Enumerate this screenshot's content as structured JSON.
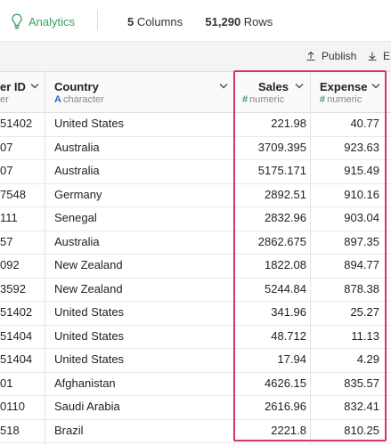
{
  "header": {
    "analytics_label": "Analytics",
    "columns_count": "5",
    "columns_label": "Columns",
    "rows_count": "51,290",
    "rows_label": "Rows"
  },
  "toolbar": {
    "publish_label": "Publish",
    "export_label": "E:"
  },
  "columns": [
    {
      "name": "er ID",
      "type_label": "er"
    },
    {
      "name": "Country",
      "type_symbol": "A",
      "type_label": "character"
    },
    {
      "name": "Sales",
      "type_symbol": "#",
      "type_label": "numeric"
    },
    {
      "name": "Expense",
      "type_symbol": "#",
      "type_label": "numeric"
    }
  ],
  "rows": [
    {
      "id": "51402",
      "country": "United States",
      "sales": "221.98",
      "expense": "40.77"
    },
    {
      "id": "07",
      "country": "Australia",
      "sales": "3709.395",
      "expense": "923.63"
    },
    {
      "id": "07",
      "country": "Australia",
      "sales": "5175.171",
      "expense": "915.49"
    },
    {
      "id": "7548",
      "country": "Germany",
      "sales": "2892.51",
      "expense": "910.16"
    },
    {
      "id": "111",
      "country": "Senegal",
      "sales": "2832.96",
      "expense": "903.04"
    },
    {
      "id": "57",
      "country": "Australia",
      "sales": "2862.675",
      "expense": "897.35"
    },
    {
      "id": "092",
      "country": "New Zealand",
      "sales": "1822.08",
      "expense": "894.77"
    },
    {
      "id": "3592",
      "country": "New Zealand",
      "sales": "5244.84",
      "expense": "878.38"
    },
    {
      "id": "51402",
      "country": "United States",
      "sales": "341.96",
      "expense": "25.27"
    },
    {
      "id": "51404",
      "country": "United States",
      "sales": "48.712",
      "expense": "11.13"
    },
    {
      "id": "51404",
      "country": "United States",
      "sales": "17.94",
      "expense": "4.29"
    },
    {
      "id": "01",
      "country": "Afghanistan",
      "sales": "4626.15",
      "expense": "835.57"
    },
    {
      "id": "0110",
      "country": "Saudi Arabia",
      "sales": "2616.96",
      "expense": "832.41"
    },
    {
      "id": "518",
      "country": "Brazil",
      "sales": "2221.8",
      "expense": "810.25"
    }
  ],
  "colors": {
    "accent_green": "#3a9d5d",
    "highlight": "#d6336c",
    "char_blue": "#2d6cc0"
  }
}
